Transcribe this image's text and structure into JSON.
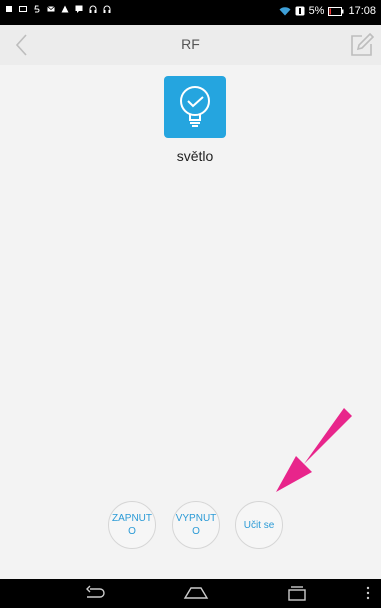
{
  "status_bar": {
    "battery_percent": "5%",
    "time": "17:08",
    "left_icons": [
      "android-icon",
      "image-icon",
      "five-icon",
      "mail-icon",
      "warning-icon",
      "chat-icon",
      "headset-icon",
      "headset-icon"
    ],
    "right_icons": [
      "wifi-icon",
      "badge-icon",
      "battery-icon"
    ]
  },
  "header": {
    "title": "RF"
  },
  "device": {
    "name": "světlo",
    "icon": "lightbulb-icon",
    "tile_color": "#25a5df"
  },
  "actions": {
    "on_label": "ZAPNUTO",
    "off_label": "VYPNUTO",
    "learn_label": "Učit se"
  },
  "colors": {
    "accent": "#2a9ad6",
    "annotation_arrow": "#e8258b"
  },
  "nav_bar": {
    "icons": [
      "back-icon",
      "home-icon",
      "recents-icon",
      "menu-icon"
    ]
  }
}
